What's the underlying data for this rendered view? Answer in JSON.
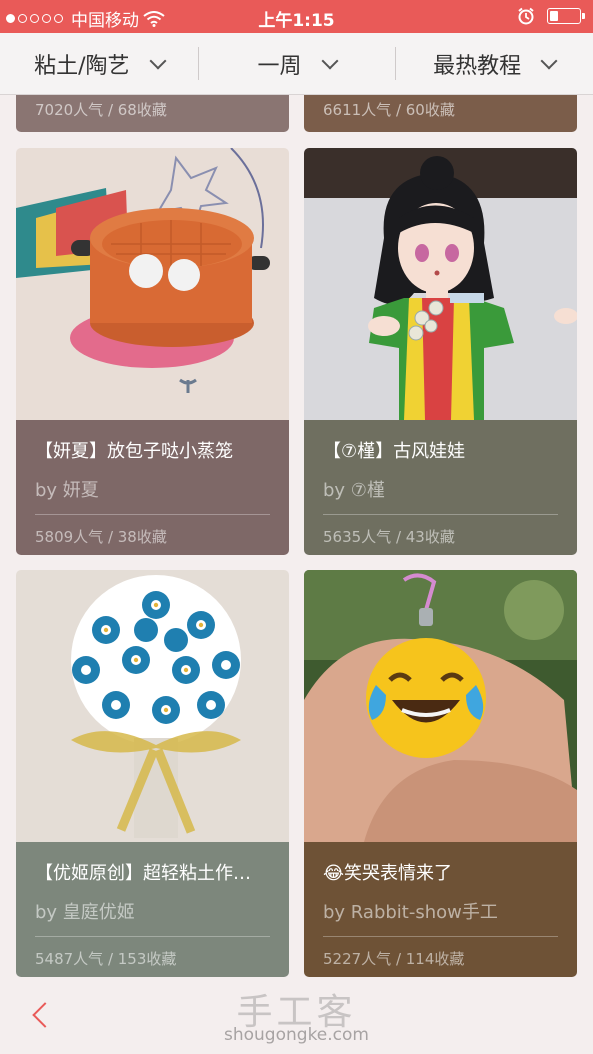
{
  "status_bar": {
    "carrier": "中国移动",
    "time": "上午1:15",
    "battery_level": 0.25
  },
  "filters": [
    {
      "label": "粘土/陶艺"
    },
    {
      "label": "一周"
    },
    {
      "label": "最热教程"
    }
  ],
  "top_partial": [
    {
      "stats": "7020人气 / 68收藏",
      "color": "#8a7572"
    },
    {
      "stats": "6611人气 / 60收藏",
      "color": "#7b5d4a"
    }
  ],
  "cards": [
    {
      "title": "【妍夏】放包子哒小蒸笼",
      "author": "by 妍夏",
      "stats": "5809人气 / 38收藏",
      "color": "#7e6867"
    },
    {
      "title": "【⑦槿】古风娃娃",
      "author": "by ⑦槿",
      "stats": "5635人气 / 43收藏",
      "color": "#6f6f60"
    },
    {
      "title": "【优姬原创】超轻粘土作…",
      "author": "by 皇庭优姬",
      "stats": "5487人气 / 153收藏",
      "color": "#7d877c"
    },
    {
      "title": "😂笑哭表情来了",
      "author": "by Rabbit-show手工",
      "stats": "5227人气 / 114收藏",
      "color": "#6e5236"
    }
  ],
  "watermark": {
    "brand": "手工客",
    "domain": "shougongke.com"
  },
  "icons": {
    "back": "chevron-left-icon",
    "wifi": "wifi-icon",
    "alarm": "alarm-icon",
    "battery": "battery-icon",
    "dropdown": "chevron-down-icon"
  },
  "colors": {
    "accent": "#e95a58",
    "background": "#f4eeee"
  }
}
